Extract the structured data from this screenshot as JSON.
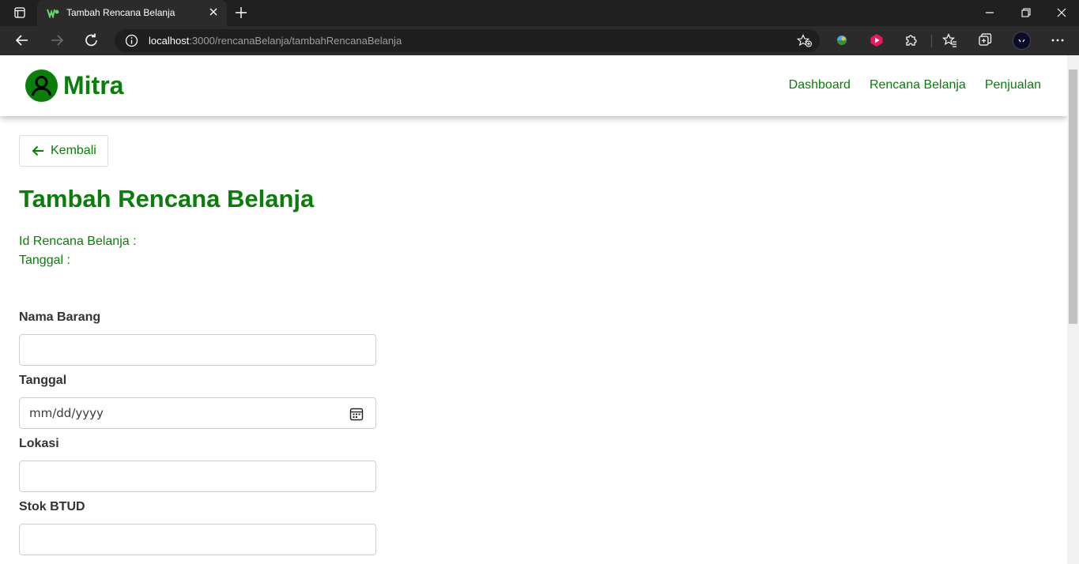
{
  "browser": {
    "tab_title": "Tambah Rencana Belanja",
    "url_host": "localhost",
    "url_path": ":3000/rencanaBelanja/tambahRencanaBelanja"
  },
  "navbar": {
    "brand": "Mitra",
    "links": [
      "Dashboard",
      "Rencana Belanja",
      "Penjualan"
    ]
  },
  "back_label": "Kembali",
  "page_title": "Tambah Rencana Belanja",
  "meta": {
    "id_label": "Id Rencana Belanja :",
    "date_label": "Tanggal :"
  },
  "form": {
    "nama_barang_label": "Nama Barang",
    "tanggal_label": "Tanggal",
    "tanggal_placeholder": "mm/dd/yyyy",
    "lokasi_label": "Lokasi",
    "stok_label": "Stok BTUD"
  },
  "colors": {
    "accent": "#0a7d0a",
    "label": "#333333",
    "chrome_dark": "#202020"
  }
}
